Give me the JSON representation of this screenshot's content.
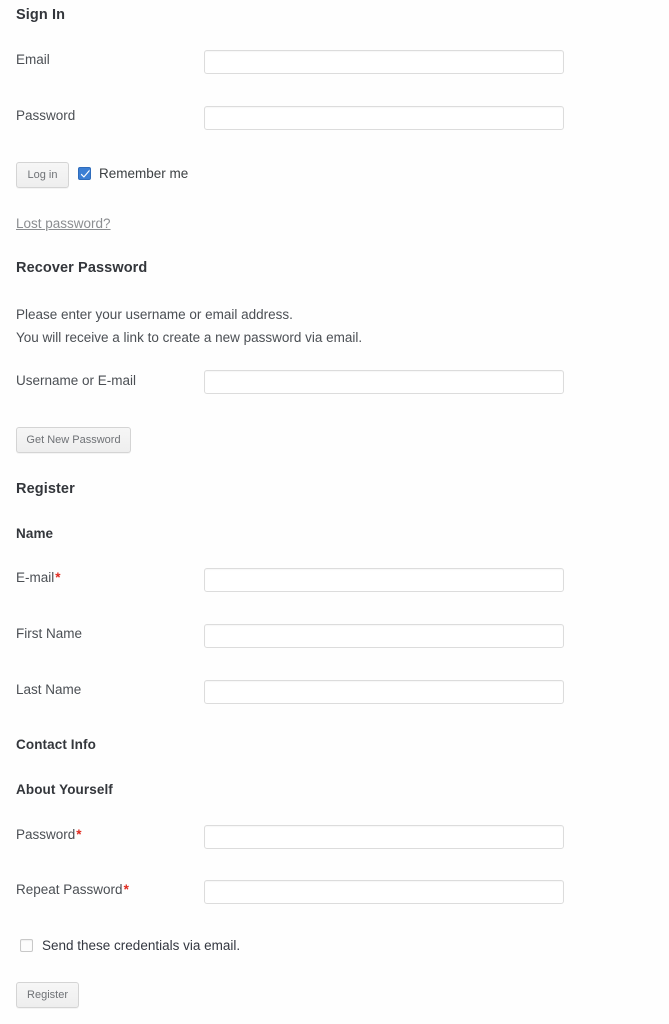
{
  "signin": {
    "heading": "Sign In",
    "email_label": "Email",
    "email_value": "",
    "email_placeholder": "",
    "password_label": "Password",
    "password_value": "",
    "password_placeholder": "",
    "login_button": "Log in",
    "remember_label": "Remember me",
    "remember_checked": true,
    "lost_password_link": "Lost password?"
  },
  "recover": {
    "heading": "Recover Password",
    "instructions_line1": "Please enter your username or email address.",
    "instructions_line2": "You will receive a link to create a new password via email.",
    "username_label": "Username or E-mail",
    "username_value": "",
    "username_placeholder": "",
    "submit_button": "Get New Password"
  },
  "register": {
    "heading": "Register",
    "name_heading": "Name",
    "email_label": "E-mail",
    "email_required_mark": "*",
    "email_value": "",
    "email_placeholder": "",
    "first_name_label": "First Name",
    "first_name_value": "",
    "first_name_placeholder": "",
    "last_name_label": "Last Name",
    "last_name_value": "",
    "last_name_placeholder": "",
    "contact_info_heading": "Contact Info",
    "about_yourself_heading": "About Yourself",
    "password_label": "Password",
    "password_required_mark": "*",
    "password_value": "",
    "password_placeholder": "",
    "repeat_password_label": "Repeat Password",
    "repeat_password_required_mark": "*",
    "repeat_password_value": "",
    "repeat_password_placeholder": "",
    "send_credentials_label": "Send these credentials via email.",
    "send_credentials_checked": false,
    "submit_button": "Register"
  },
  "colors": {
    "required_asterisk": "#e02b20",
    "checkbox_checked": "#3c7fd4",
    "text": "#4b4f54",
    "heading": "#33363b",
    "link": "#8b8d90",
    "input_border": "#dcdcdc",
    "button_face": "#f1f1f1"
  }
}
